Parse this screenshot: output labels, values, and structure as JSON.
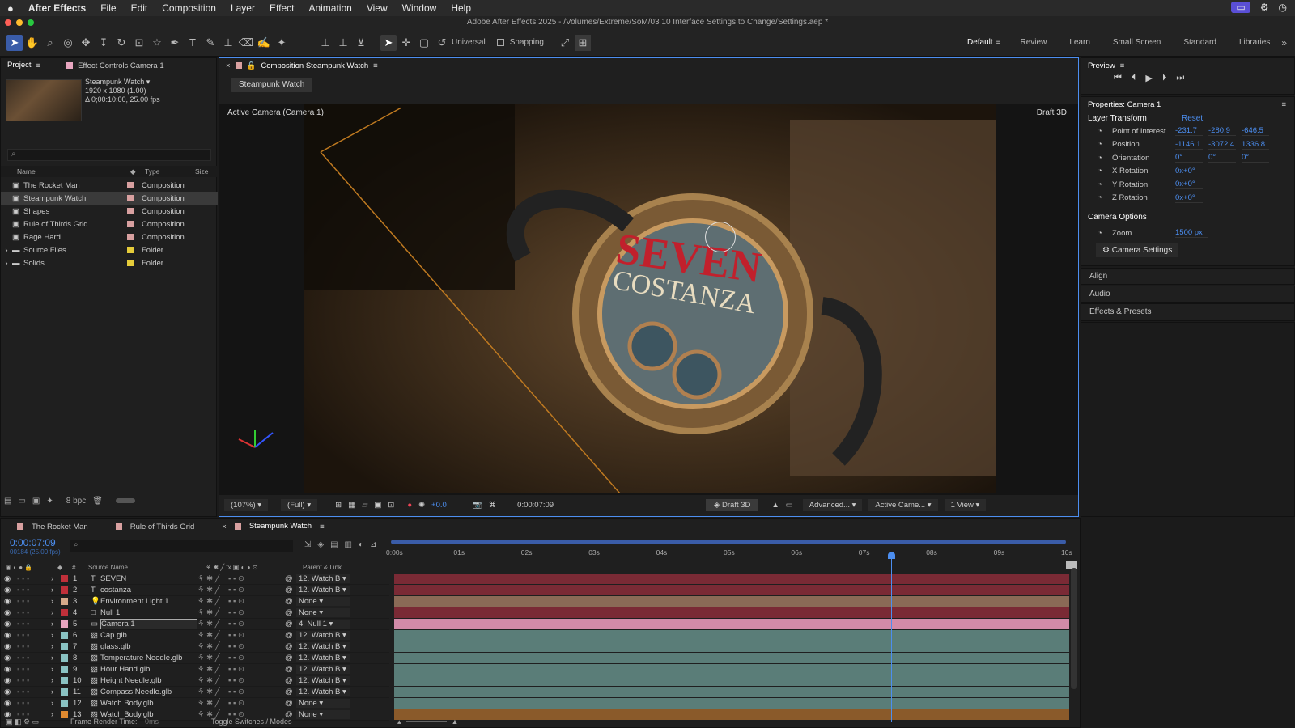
{
  "menubar": {
    "apple": "",
    "app": "After Effects",
    "items": [
      "File",
      "Edit",
      "Composition",
      "Layer",
      "Effect",
      "Animation",
      "View",
      "Window",
      "Help"
    ]
  },
  "window_title": "Adobe After Effects 2025 - /Volumes/Extreme/SoM/03 10 Interface Settings to Change/Settings.aep *",
  "toolbar": {
    "universal": "Universal",
    "snapping": "Snapping",
    "workspaces": [
      "Default",
      "Review",
      "Learn",
      "Small Screen",
      "Standard",
      "Libraries"
    ],
    "active_workspace": "Default"
  },
  "project": {
    "tab_project": "Project",
    "tab_effect": "Effect Controls Camera 1",
    "comp_name": "Steampunk Watch ▾",
    "comp_res": "1920 x 1080 (1.00)",
    "comp_dur": "Δ 0;00:10:00, 25.00 fps",
    "col_name": "Name",
    "col_type": "Type",
    "col_size": "Size",
    "items": [
      {
        "name": "The Rocket Man",
        "type": "Composition",
        "color": "#d8a0a0",
        "kind": "comp"
      },
      {
        "name": "Steampunk Watch",
        "type": "Composition",
        "color": "#d8a0a0",
        "kind": "comp",
        "selected": true
      },
      {
        "name": "Shapes",
        "type": "Composition",
        "color": "#d8a0a0",
        "kind": "comp"
      },
      {
        "name": "Rule of Thirds Grid",
        "type": "Composition",
        "color": "#d8a0a0",
        "kind": "comp"
      },
      {
        "name": "Rage Hard",
        "type": "Composition",
        "color": "#d8a0a0",
        "kind": "comp"
      },
      {
        "name": "Source Files",
        "type": "Folder",
        "color": "#e5cc3a",
        "kind": "folder"
      },
      {
        "name": "Solids",
        "type": "Folder",
        "color": "#e5cc3a",
        "kind": "folder"
      }
    ],
    "bpc": "8 bpc"
  },
  "composition": {
    "tab": "Composition Steampunk Watch",
    "sub_tab": "Steampunk Watch",
    "camera_label": "Active Camera (Camera 1)",
    "renderer": "Draft 3D",
    "text_seven": "SEVEN",
    "text_costanza": "COSTANZA",
    "bottom": {
      "zoom": "(107%)",
      "quality": "(Full)",
      "exposure": "+0.0",
      "timecode": "0:00:07:09",
      "draft3d": "Draft 3D",
      "advanced": "Advanced...",
      "camera": "Active Came...",
      "view": "1 View"
    }
  },
  "preview": {
    "title": "Preview"
  },
  "properties": {
    "title": "Properties: Camera 1",
    "section": "Layer Transform",
    "reset": "Reset",
    "rows": [
      {
        "label": "Point of Interest",
        "v": [
          "-231.7",
          "-280.9",
          "-646.5"
        ]
      },
      {
        "label": "Position",
        "v": [
          "-1146.1",
          "-3072.4",
          "1336.8"
        ]
      },
      {
        "label": "Orientation",
        "v": [
          "0°",
          "0°",
          "0°"
        ]
      },
      {
        "label": "X Rotation",
        "v": [
          "0x+0°"
        ]
      },
      {
        "label": "Y Rotation",
        "v": [
          "0x+0°"
        ]
      },
      {
        "label": "Z Rotation",
        "v": [
          "0x+0°"
        ]
      }
    ],
    "camera_options": "Camera Options",
    "zoom_label": "Zoom",
    "zoom_value": "1500 px",
    "camera_settings": "Camera Settings"
  },
  "side_panels": [
    "Align",
    "Audio",
    "Effects & Presets"
  ],
  "timeline": {
    "tabs": [
      "The Rocket Man",
      "Rule of Thirds Grid",
      "Steampunk Watch"
    ],
    "active_tab": "Steampunk Watch",
    "timecode": "0:00:07:09",
    "frame_info": "00184 (25.00 fps)",
    "col_source": "Source Name",
    "col_parent": "Parent & Link",
    "ruler": [
      "0:00s",
      "01s",
      "02s",
      "03s",
      "04s",
      "05s",
      "06s",
      "07s",
      "08s",
      "09s",
      "10s"
    ],
    "playhead": 0.736,
    "layers": [
      {
        "num": "1",
        "name": "SEVEN",
        "color": "#c0303a",
        "kind": "T",
        "parent": "12. Watch B",
        "bar": "#7a2a35"
      },
      {
        "num": "2",
        "name": "costanza",
        "color": "#c0303a",
        "kind": "T",
        "parent": "12. Watch B",
        "bar": "#7a2a35"
      },
      {
        "num": "3",
        "name": "Environment Light 1",
        "color": "#d6a98a",
        "kind": "light",
        "parent": "None",
        "bar": "#8a6a56"
      },
      {
        "num": "4",
        "name": "Null 1",
        "color": "#c0303a",
        "kind": "null",
        "parent": "None",
        "bar": "#7a2a35"
      },
      {
        "num": "5",
        "name": "Camera 1",
        "color": "#e8a6c0",
        "kind": "cam",
        "parent": "4. Null 1",
        "bar": "#d28aa8",
        "selected": true
      },
      {
        "num": "6",
        "name": "Cap.glb",
        "color": "#8ac2c2",
        "kind": "3d",
        "parent": "12. Watch B",
        "bar": "#5a7d78"
      },
      {
        "num": "7",
        "name": "glass.glb",
        "color": "#8ac2c2",
        "kind": "3d",
        "parent": "12. Watch B",
        "bar": "#5a7d78"
      },
      {
        "num": "8",
        "name": "Temperature Needle.glb",
        "color": "#8ac2c2",
        "kind": "3d",
        "parent": "12. Watch B",
        "bar": "#5a7d78"
      },
      {
        "num": "9",
        "name": "Hour Hand.glb",
        "color": "#8ac2c2",
        "kind": "3d",
        "parent": "12. Watch B",
        "bar": "#5a7d78"
      },
      {
        "num": "10",
        "name": "Height Needle.glb",
        "color": "#8ac2c2",
        "kind": "3d",
        "parent": "12. Watch B",
        "bar": "#5a7d78"
      },
      {
        "num": "11",
        "name": "Compass Needle.glb",
        "color": "#8ac2c2",
        "kind": "3d",
        "parent": "12. Watch B",
        "bar": "#5a7d78"
      },
      {
        "num": "12",
        "name": "Watch Body.glb",
        "color": "#8ac2c2",
        "kind": "3d",
        "parent": "None",
        "bar": "#5a7d78"
      },
      {
        "num": "13",
        "name": "Watch Body.glb",
        "color": "#e08a30",
        "kind": "3d",
        "parent": "None",
        "bar": "#8a5a2a"
      }
    ],
    "footer_render": "Frame Render Time:",
    "footer_ms": "0ms",
    "footer_toggle": "Toggle Switches / Modes"
  }
}
